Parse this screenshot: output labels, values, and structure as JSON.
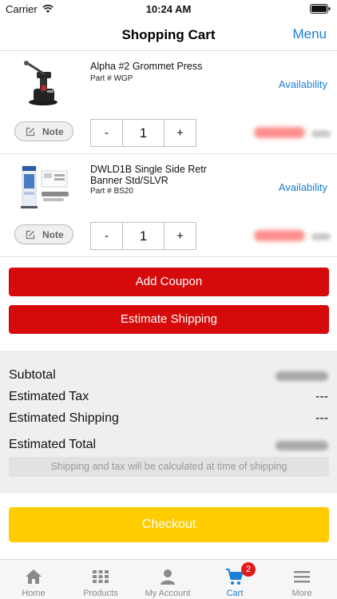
{
  "status_bar": {
    "carrier": "Carrier",
    "time": "10:24 AM"
  },
  "nav": {
    "title": "Shopping Cart",
    "menu_label": "Menu"
  },
  "cart": {
    "items": [
      {
        "name": "Alpha #2 Grommet Press",
        "part": "Part # WGP",
        "availability_label": "Availability",
        "note_label": "Note",
        "quantity": "1",
        "minus": "-",
        "plus": "+"
      },
      {
        "name": "DWLD1B Single Side Retr Banner Std/SLVR",
        "part": "Part # BS20",
        "availability_label": "Availability",
        "note_label": "Note",
        "quantity": "1",
        "minus": "-",
        "plus": "+"
      }
    ]
  },
  "actions": {
    "add_coupon": "Add Coupon",
    "estimate_shipping": "Estimate Shipping"
  },
  "summary": {
    "subtotal_label": "Subtotal",
    "tax_label": "Estimated Tax",
    "tax_value": "---",
    "shipping_label": "Estimated Shipping",
    "shipping_value": "---",
    "total_label": "Estimated Total",
    "note": "Shipping and tax will be calculated at time of shipping"
  },
  "checkout_label": "Checkout",
  "tabs": [
    {
      "label": "Home",
      "icon": "home-icon"
    },
    {
      "label": "Products",
      "icon": "grid-icon"
    },
    {
      "label": "My Account",
      "icon": "person-icon"
    },
    {
      "label": "Cart",
      "icon": "cart-icon",
      "active": true,
      "badge": "2"
    },
    {
      "label": "More",
      "icon": "menu-icon"
    }
  ],
  "colors": {
    "accent_blue": "#1a7fd6",
    "primary_red": "#d60a0a",
    "checkout_yellow": "#ffcc00",
    "badge_red": "#e01b1b"
  }
}
